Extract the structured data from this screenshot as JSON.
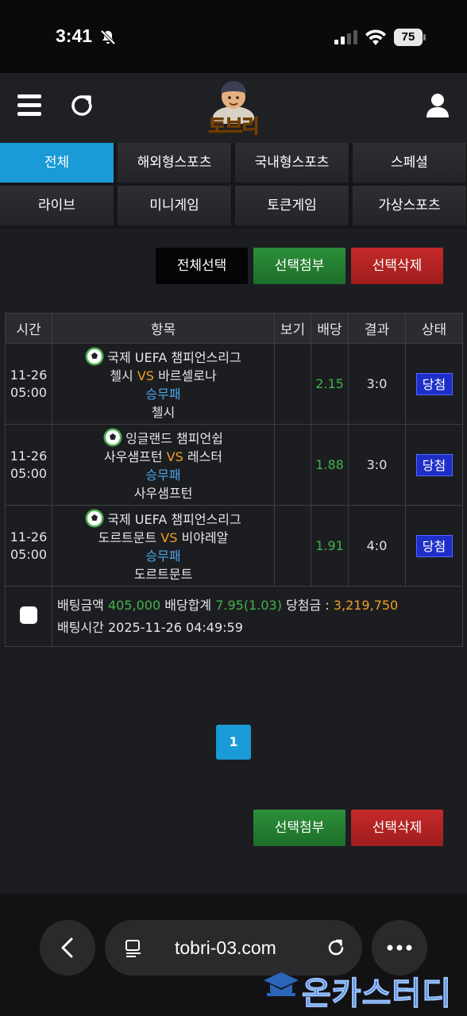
{
  "status_bar": {
    "time": "3:41",
    "battery": "75"
  },
  "header": {
    "logo_text": "토브리"
  },
  "tabs": [
    {
      "label": "전체",
      "active": true
    },
    {
      "label": "해외형스포츠"
    },
    {
      "label": "국내형스포츠"
    },
    {
      "label": "스페셜"
    },
    {
      "label": "라이브"
    },
    {
      "label": "미니게임"
    },
    {
      "label": "토큰게임"
    },
    {
      "label": "가상스포츠"
    }
  ],
  "top_actions": {
    "select_all": "전체선택",
    "attach": "선택첨부",
    "delete": "선택삭제"
  },
  "table": {
    "headers": [
      "시간",
      "항목",
      "보기",
      "배당",
      "결과",
      "상태"
    ],
    "rows": [
      {
        "date": "11-26",
        "time": "05:00",
        "league": "국제 UEFA 챔피언스리그",
        "home": "첼시",
        "vs": "VS",
        "away": "바르셀로나",
        "market": "승무패",
        "pick": "첼시",
        "view": "",
        "odds": "2.15",
        "result": "3:0",
        "status": "당첨"
      },
      {
        "date": "11-26",
        "time": "05:00",
        "league": "잉글랜드 챔피언쉽",
        "home": "사우샘프턴",
        "vs": "VS",
        "away": "레스터",
        "market": "승무패",
        "pick": "사우샘프턴",
        "view": "",
        "odds": "1.88",
        "result": "3:0",
        "status": "당첨"
      },
      {
        "date": "11-26",
        "time": "05:00",
        "league": "국제 UEFA 챔피언스리그",
        "home": "도르트문트",
        "vs": "VS",
        "away": "비야레알",
        "market": "승무패",
        "pick": "도르트문트",
        "view": "",
        "odds": "1.91",
        "result": "4:0",
        "status": "당첨"
      }
    ],
    "summary": {
      "bet_amount_label": "배팅금액",
      "bet_amount": "405,000",
      "total_odds_label": "배당합계",
      "total_odds": "7.95(1.03)",
      "win_label": "당첨금 :",
      "win_amount": "3,219,750",
      "bet_time_label": "배팅시간",
      "bet_time": "2025-11-26 04:49:59"
    }
  },
  "pagination": {
    "current": "1"
  },
  "bottom_actions": {
    "attach": "선택첨부",
    "delete": "선택삭제"
  },
  "browser": {
    "url": "tobri-03.com"
  },
  "watermark": {
    "text": "온카스터디"
  },
  "colors": {
    "accent": "#1a9ad6",
    "green": "#3fb44a",
    "orange": "#f0a020",
    "badge": "#1e2fc9",
    "red": "#c52a2a"
  }
}
